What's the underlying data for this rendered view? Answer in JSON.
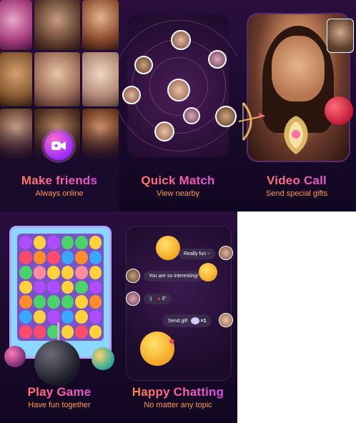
{
  "tiles": [
    {
      "title": "Make friends",
      "subtitle": "Always online"
    },
    {
      "title": "Quick Match",
      "subtitle": "View nearby"
    },
    {
      "title": "Video Call",
      "subtitle": "Send special gifts"
    },
    {
      "title": "Play Game",
      "subtitle": "Have fun together"
    },
    {
      "title": "Happy Chatting",
      "subtitle": "No matter any topic"
    }
  ],
  "chat": {
    "msg1": "Really fun ~",
    "msg2": "You are so interesting!",
    "msg3_emoji": ":)",
    "msg3_gift": "3\"",
    "msg4": "Send gift",
    "msg4_count": "×1"
  },
  "colors": {
    "background": "#1a0a2c",
    "title_gradient": [
      "#ff8a3c",
      "#ff5fa2",
      "#c24bff"
    ],
    "subtitle": "#ff9a56"
  },
  "icons": [
    "video-camera-icon"
  ]
}
